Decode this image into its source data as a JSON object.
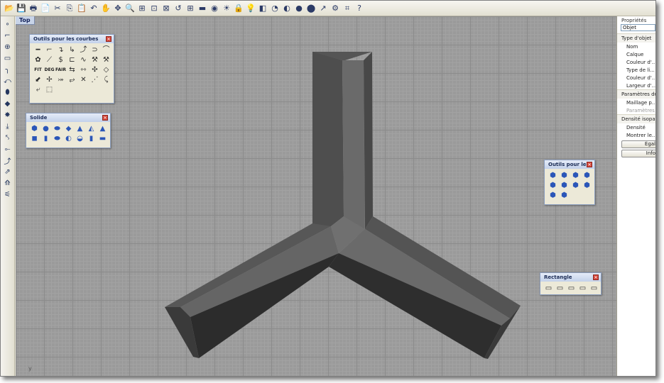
{
  "viewport": {
    "label": "Top",
    "axis_label": "y"
  },
  "toolbar": {
    "icons": [
      "open-folder-icon",
      "save-icon",
      "print-icon",
      "import-icon",
      "cut-icon",
      "copy-icon",
      "paste-icon",
      "undo-icon",
      "pan-icon",
      "rotate-view-icon",
      "zoom-icon",
      "zoom-window-icon",
      "zoom-extents-icon",
      "zoom-selected-icon",
      "undo-view-icon",
      "four-viewports-icon",
      "point-icon",
      "hide-icon",
      "show-icon",
      "lock-icon",
      "light-icon",
      "layer-icon",
      "color-icon",
      "shade-icon",
      "render-icon",
      "sphere-icon",
      "pointer-icon",
      "settings-icon",
      "snap-icon",
      "help-icon"
    ],
    "glyphs": [
      "📂",
      "💾",
      "🖶",
      "📄",
      "✂",
      "⎘",
      "📋",
      "↶",
      "✋",
      "✥",
      "🔍",
      "⊞",
      "⊡",
      "⊠",
      "↺",
      "⊞",
      "▬",
      "◉",
      "☀",
      "🔒",
      "💡",
      "◧",
      "◔",
      "◐",
      "●",
      "⬤",
      "↗",
      "⚙",
      "⌗",
      "?"
    ]
  },
  "left_toolbar": {
    "icons": [
      "point-tool-icon",
      "polyline-tool-icon",
      "circle-tool-icon",
      "rectangle-tool-icon",
      "arc-tool-icon",
      "curve-tool-icon",
      "surface-tool-icon",
      "plane-tool-icon",
      "explode-tool-icon",
      "transform-tool-icon",
      "dimension-tool-icon",
      "join-tool-icon",
      "fillet-tool-icon",
      "move-tool-icon",
      "analyze-tool-icon",
      "render-tool-icon"
    ],
    "glyphs": [
      "∘",
      "⌐",
      "⊕",
      "▭",
      "╮",
      "⤺",
      "⬮",
      "◆",
      "✸",
      "⤓",
      "⤣",
      "⟜",
      "⤴",
      "⇗",
      "⟰",
      "⚟"
    ]
  },
  "panels": {
    "curves": {
      "title": "Outils pour les courbes",
      "glyphs": [
        "━",
        "⌐",
        "↴",
        "↳",
        "⤴",
        "⊃",
        "⌒",
        "✿",
        "⟋",
        "$",
        "⊏",
        "∿",
        "⚒",
        "⚒",
        "FIT",
        "DEG",
        "FAIR",
        "⇆",
        "⇿",
        "✣",
        "◇",
        "⬋",
        "✢",
        "⤖",
        "⥂",
        "✕",
        "⋰",
        "⤹",
        "⤶",
        "⬚"
      ]
    },
    "solids": {
      "title": "Solide",
      "glyphs": [
        "⬢",
        "●",
        "⬬",
        "◆",
        "▲",
        "◭",
        "▲",
        "◼",
        "▮",
        "⬬",
        "◐",
        "◒",
        "▮",
        "▬"
      ]
    },
    "solid_tools": {
      "title": "Outils pour les s...",
      "glyphs": [
        "⬢",
        "⬢",
        "⬢",
        "⬢",
        "⬢",
        "⬢",
        "⬢",
        "⬢",
        "⬢",
        "⬢"
      ]
    },
    "rectangle": {
      "title": "Rectangle",
      "glyphs": [
        "▭",
        "▭",
        "▭",
        "▭",
        "▭"
      ]
    }
  },
  "properties": {
    "title": "Propriétés",
    "selector": "Objet",
    "section_object_type": "Type d'objet",
    "rows": [
      "Nom",
      "Calque",
      "Couleur d'...",
      "Type de li...",
      "Couleur d'...",
      "Largeur d'..."
    ],
    "section_params": "Paramètres du",
    "params_rows": [
      "Maillage p..."
    ],
    "params_disabled": [
      "Paramètres"
    ],
    "section_density": "Densité isoparam",
    "density_rows": [
      "Densité",
      "Montrer le..."
    ],
    "buttons": [
      "Égal",
      "Info"
    ]
  }
}
